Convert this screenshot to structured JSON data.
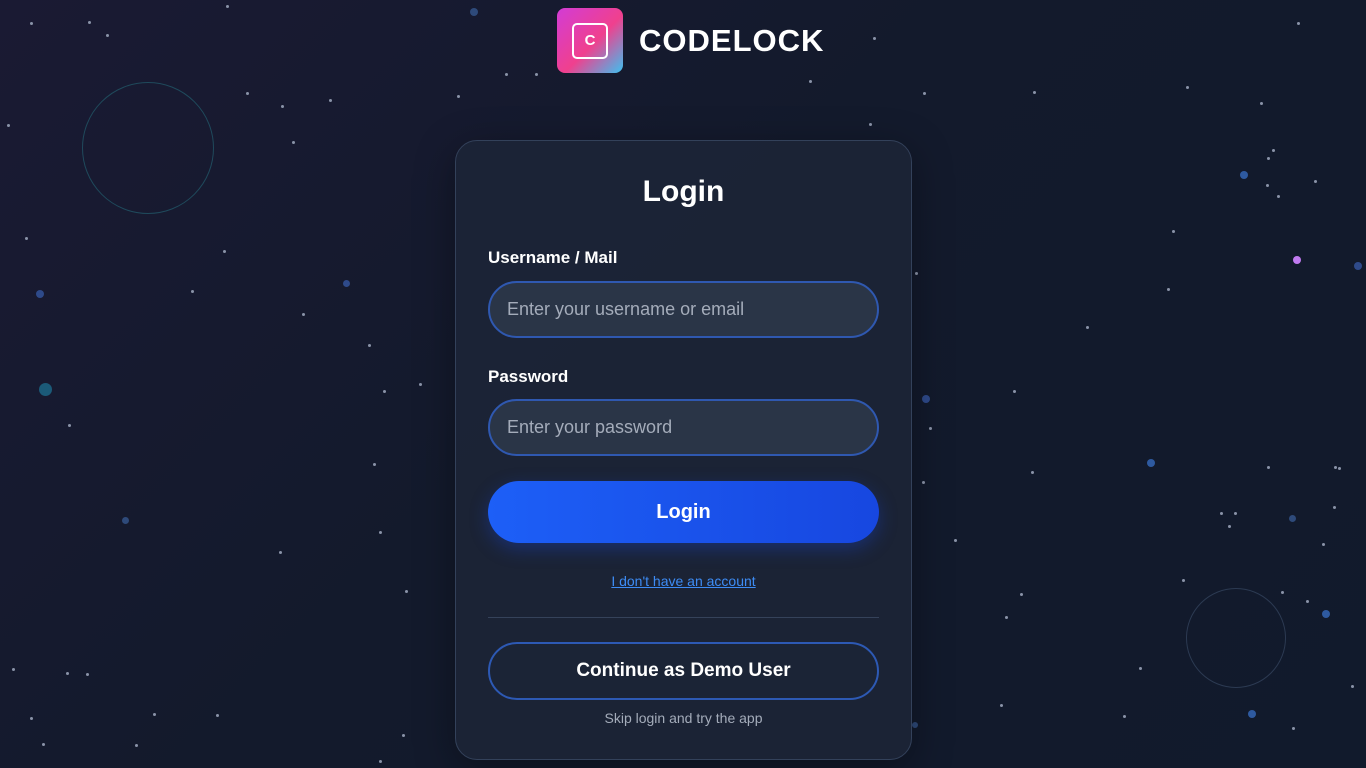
{
  "brand": {
    "name": "CODELOCK",
    "logo_letter": "C",
    "logo_gradient": [
      "#d23cd6",
      "#f0408e",
      "#3cc1f0"
    ]
  },
  "login_form": {
    "title": "Login",
    "username_label": "Username / Mail",
    "username_placeholder": "Enter your username or email",
    "username_value": "",
    "password_label": "Password",
    "password_placeholder": "Enter your password",
    "password_value": "",
    "submit_label": "Login",
    "no_account_link": "I don't have an account",
    "demo_button_label": "Continue as Demo User",
    "demo_hint": "Skip login and try the app"
  },
  "colors": {
    "background": "#131a2c",
    "card": "#1e2738",
    "accent": "#1d5ff7",
    "link": "#3d8cf5"
  }
}
